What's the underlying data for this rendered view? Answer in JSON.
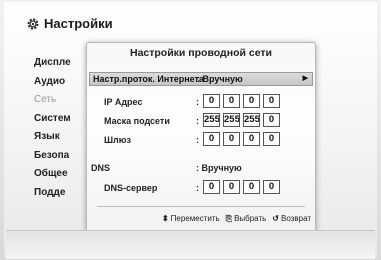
{
  "header": {
    "title": "Настройки",
    "icon": "gear-icon"
  },
  "menu": {
    "items": [
      {
        "label": "Диспле",
        "dim": false
      },
      {
        "label": "Аудио",
        "dim": false
      },
      {
        "label": "Сеть",
        "dim": true
      },
      {
        "label": "Систем",
        "dim": false
      },
      {
        "label": "Язык",
        "dim": false
      },
      {
        "label": "Безопа",
        "dim": false
      },
      {
        "label": "Общее",
        "dim": false
      },
      {
        "label": "Подде",
        "dim": false
      }
    ]
  },
  "dialog": {
    "title": "Настройки проводной сети",
    "protocol_label": "Настр.проток. Интернета",
    "protocol_value": ": Вручную",
    "ip_label": "IP Адрес",
    "ip": [
      "0",
      "0",
      "0",
      "0"
    ],
    "mask_label": "Маска подсети",
    "mask": [
      "255",
      "255",
      "255",
      "0"
    ],
    "gateway_label": "Шлюз",
    "gateway": [
      "0",
      "0",
      "0",
      "0"
    ],
    "dns_label": "DNS",
    "dns_value": ": Вручную",
    "dns_server_label": "DNS-сервер",
    "dns_server": [
      "0",
      "0",
      "0",
      "0"
    ],
    "colon": ":"
  },
  "hints": {
    "move": "Переместить",
    "select": "Выбрать",
    "back": "Возврат",
    "move_icon": "⬍",
    "select_icon": "⎘",
    "back_icon": "↺"
  }
}
